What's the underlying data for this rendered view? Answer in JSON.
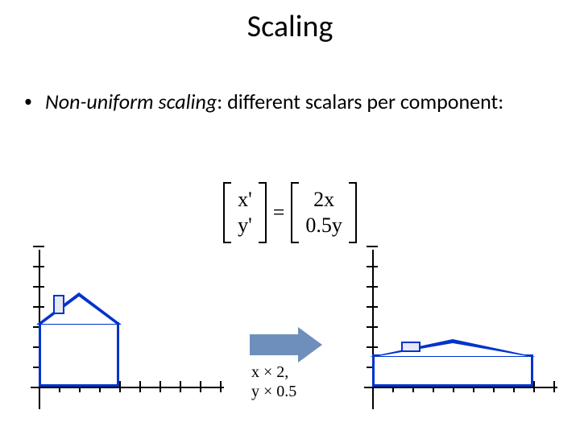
{
  "title": "Scaling",
  "bullet": {
    "dot": "•",
    "emphasis": "Non-uniform scaling",
    "rest": ": different scalars per component:"
  },
  "equation": {
    "left_rows": [
      "x'",
      "y'"
    ],
    "equals": "=",
    "right_rows": [
      "2x",
      "0.5y"
    ]
  },
  "arrow_label": {
    "line1": "x × 2,",
    "line2": "y × 0.5"
  },
  "colors": {
    "shape_stroke": "#0033cc",
    "arrow_fill": "#6e8fbc"
  },
  "chart_data": [
    {
      "type": "line",
      "title": "Original house on axes",
      "xlim": [
        0,
        9
      ],
      "ylim": [
        0,
        7
      ],
      "series": [
        {
          "name": "house-body",
          "x": [
            0,
            4,
            4,
            0,
            0
          ],
          "y": [
            0,
            0,
            3,
            3,
            0
          ]
        },
        {
          "name": "house-roof",
          "x": [
            0,
            2,
            4
          ],
          "y": [
            3,
            4.5,
            3
          ]
        },
        {
          "name": "chimney",
          "x": [
            0.7,
            0.7,
            1.1,
            1.1
          ],
          "y": [
            3.6,
            4.3,
            4.3,
            3.9
          ]
        }
      ]
    },
    {
      "type": "line",
      "title": "Scaled house (x×2, y×0.5) on axes",
      "xlim": [
        0,
        9
      ],
      "ylim": [
        0,
        7
      ],
      "series": [
        {
          "name": "house-body",
          "x": [
            0,
            8,
            8,
            0,
            0
          ],
          "y": [
            0,
            0,
            1.5,
            1.5,
            0
          ]
        },
        {
          "name": "house-roof",
          "x": [
            0,
            4,
            8
          ],
          "y": [
            1.5,
            2.25,
            1.5
          ]
        },
        {
          "name": "chimney",
          "x": [
            1.4,
            1.4,
            2.2,
            2.2
          ],
          "y": [
            1.8,
            2.15,
            2.15,
            1.95
          ]
        }
      ]
    }
  ]
}
